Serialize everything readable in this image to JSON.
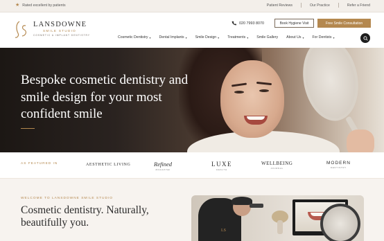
{
  "topbar": {
    "rated": "Rated excellent by patients",
    "links": [
      "Patient Reviews",
      "Our Practice",
      "Refer a Friend"
    ]
  },
  "brand": {
    "name": "LANSDOWNE",
    "sub": "SMILE STUDIO",
    "tagline": "COSMETIC & IMPLANT DENTISTRY",
    "accent": "#b4884f"
  },
  "header": {
    "phone": "020 7993 8070",
    "book_button": "Book Hygiene Visit",
    "consult_button": "Free Smile Consultation"
  },
  "nav": {
    "items": [
      {
        "label": "Cosmetic Dentistry",
        "dropdown": true
      },
      {
        "label": "Dental Implants",
        "dropdown": true
      },
      {
        "label": "Smile Design",
        "dropdown": true
      },
      {
        "label": "Treatments",
        "dropdown": true
      },
      {
        "label": "Smile Gallery",
        "dropdown": false
      },
      {
        "label": "About Us",
        "dropdown": true
      },
      {
        "label": "For Dentists",
        "dropdown": true
      }
    ]
  },
  "hero": {
    "title": "Bespoke cosmetic dentistry and smile design for your most confident smile"
  },
  "featured": {
    "label": "AS FEATURED IN",
    "brands": [
      {
        "name": "AESTHETIC LIVING",
        "sub": ""
      },
      {
        "name": "Refined",
        "sub": "MAGAZINE"
      },
      {
        "name": "LUXE",
        "sub": "HEALTH"
      },
      {
        "name": "WELLBEING",
        "sub": "JOURNAL"
      },
      {
        "name": "MODERN",
        "sub": "DENTISTRY"
      }
    ]
  },
  "welcome": {
    "label": "WELCOME TO LANSDOWNE SMILE STUDIO",
    "title": "Cosmetic dentistry. Naturally, beautifully you."
  },
  "icons": [
    "star-icon",
    "phone-icon",
    "search-icon",
    "chevron-down-icon",
    "logo-monogram-icon"
  ]
}
